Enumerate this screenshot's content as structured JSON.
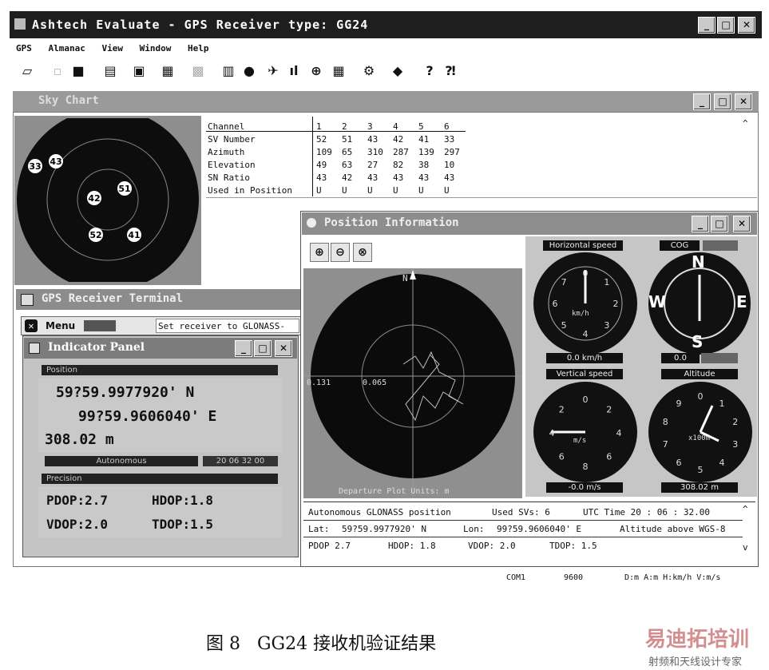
{
  "app": {
    "title": "Ashtech Evaluate - GPS Receiver type:  GG24",
    "menu": [
      "GPS",
      "Almanac",
      "View",
      "Window",
      "Help"
    ]
  },
  "sky_chart": {
    "title": "Sky Chart",
    "satellites": [
      "33",
      "43",
      "42",
      "51",
      "52",
      "41"
    ],
    "table": {
      "headers": [
        "Channel",
        "1",
        "2",
        "3",
        "4",
        "5",
        "6"
      ],
      "rows": [
        {
          "label": "SV Number",
          "values": [
            "52",
            "51",
            "43",
            "42",
            "41",
            "33"
          ]
        },
        {
          "label": "Azimuth",
          "values": [
            "109",
            "65",
            "310",
            "287",
            "139",
            "297"
          ]
        },
        {
          "label": "Elevation",
          "values": [
            "49",
            "63",
            "27",
            "82",
            "38",
            "10"
          ]
        },
        {
          "label": "SN Ratio",
          "values": [
            "43",
            "42",
            "43",
            "43",
            "43",
            "43"
          ]
        },
        {
          "label": "Used in Position",
          "values": [
            "U",
            "U",
            "U",
            "U",
            "U",
            "U"
          ]
        }
      ]
    }
  },
  "terminal": {
    "title": "GPS Receiver Terminal",
    "menu_label": "Menu",
    "command": "Set receiver to GLONASS-"
  },
  "indicator": {
    "title": "Indicator Panel",
    "position_label": "Position",
    "lat": "59?59.9977920' N",
    "lon": "99?59.9606040' E",
    "alt": "308.02 m",
    "mode": "Autonomous",
    "time": "20 06 32 00",
    "precision_label": "Precision",
    "pdop": "PDOP:2.7",
    "hdop": "HDOP:1.8",
    "vdop": "VDOP:2.0",
    "tdop": "TDOP:1.5"
  },
  "position_info": {
    "title": "Position Information",
    "plot": {
      "north": "N",
      "left_tick": "0.131",
      "mid_tick": "0.065",
      "footer": "Departure Plot  Units: m"
    },
    "gauges": {
      "horizontal": {
        "label": "Horizontal speed",
        "value": "0.0 km/h",
        "unit": "km/h",
        "ticks": [
          "0",
          "1",
          "2",
          "3",
          "4",
          "5",
          "6",
          "7"
        ]
      },
      "cog": {
        "label": "COG",
        "value": "0.0",
        "n": "N",
        "e": "E",
        "s": "S",
        "w": "W"
      },
      "vertical": {
        "label": "Vertical speed",
        "value": "-0.0 m/s",
        "unit": "m/s",
        "ticks": [
          "0",
          "2",
          "4",
          "6",
          "8",
          "6",
          "4",
          "2"
        ]
      },
      "altitude": {
        "label": "Altitude",
        "value": "308.02 m",
        "unit": "x100m",
        "ticks": [
          "0",
          "1",
          "2",
          "3",
          "4",
          "5",
          "6",
          "7",
          "8",
          "9"
        ]
      }
    },
    "status": {
      "row1": [
        "Autonomous GLONASS position",
        "Used SVs:  6",
        "UTC Time  20 : 06 : 32.00"
      ],
      "lat_label": "Lat:",
      "lat": "59?59.9977920'  N",
      "lon_label": "Lon:",
      "lon": "99?59.9606040'  E",
      "alt_label": "Altitude above WGS-8",
      "pdop": "PDOP  2.7",
      "hdop": "HDOP:  1.8",
      "vdop": "VDOP:  2.0",
      "tdop": "TDOP:  1.5"
    }
  },
  "statusbar": {
    "port": "COM1",
    "baud": "9600",
    "units": "D:m A:m H:km/h V:m/s"
  },
  "caption": "图 8   GG24 接收机验证结果",
  "watermark": {
    "top": "易迪拓培训",
    "bottom": "射频和天线设计专家"
  }
}
